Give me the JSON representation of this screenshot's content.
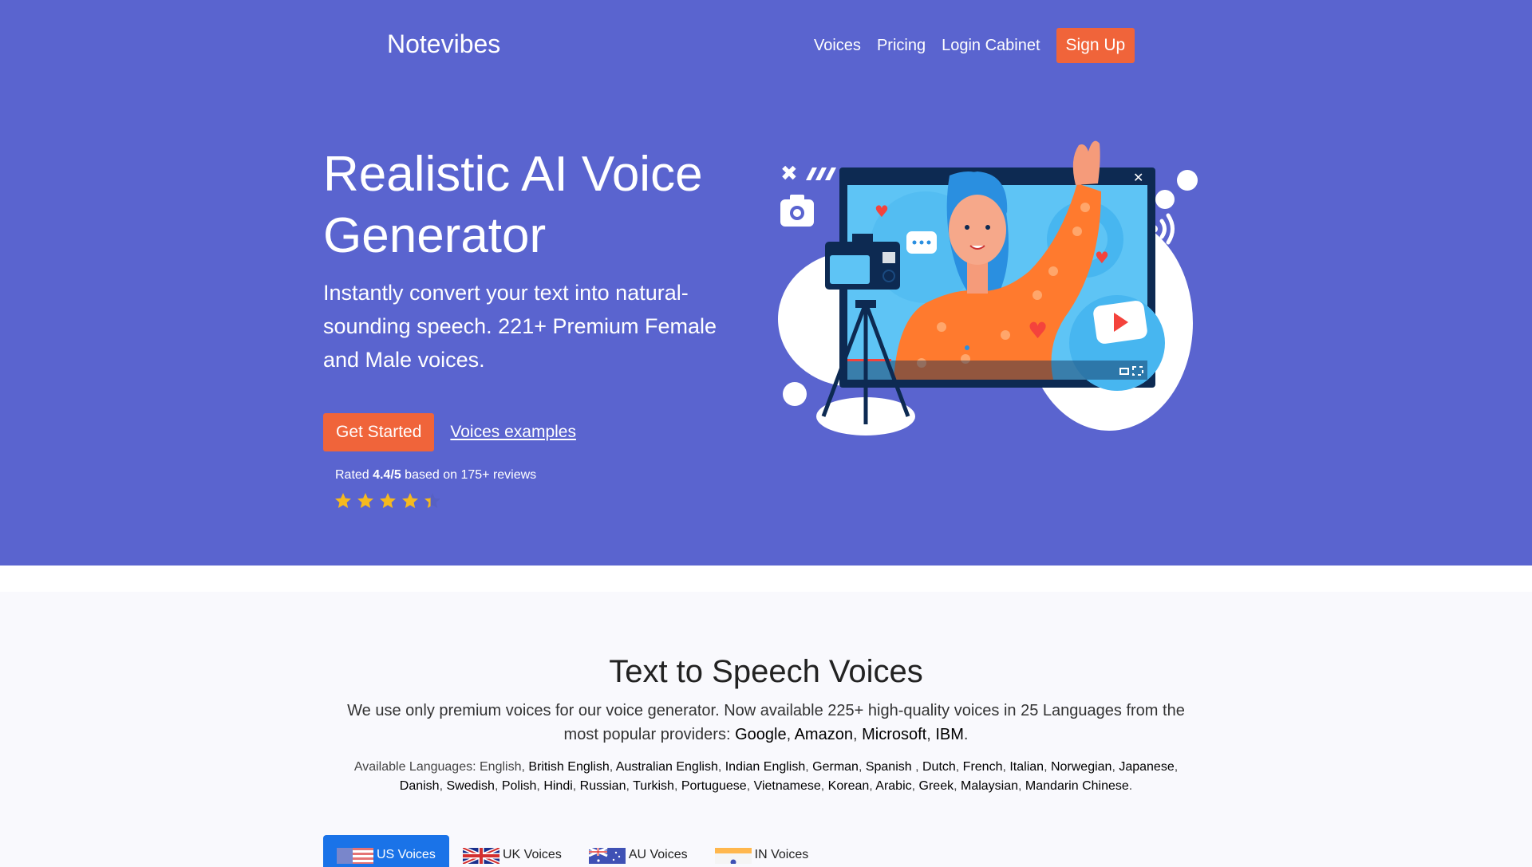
{
  "navbar": {
    "brand": "Notevibes",
    "links": [
      {
        "label": "Voices"
      },
      {
        "label": "Pricing"
      },
      {
        "label": "Login Cabinet"
      }
    ],
    "signup_label": "Sign Up"
  },
  "hero": {
    "title": "Realistic AI Voice Generator",
    "subtitle": "Instantly convert your text into natural-sounding speech. 221+ Premium Female and Male voices.",
    "get_started_label": "Get Started",
    "voices_examples_label": "Voices examples",
    "rating": {
      "prefix": "Rated ",
      "score": "4.4/5",
      "suffix": " based on 175+ reviews",
      "value": 4.4,
      "max": 5
    },
    "illustration_alt": "woman waving in video call with camera on tripod"
  },
  "voices_section": {
    "title": "Text to Speech Voices",
    "description_prefix": "We use only premium voices for our voice generator. Now available 225+ high-quality voices in 25 Languages from the most popular providers: ",
    "providers": [
      "Google",
      "Amazon",
      "Microsoft",
      "IBM"
    ],
    "languages_label": "Available Languages: ",
    "languages": [
      "English",
      "British English",
      "Australian English",
      "Indian English",
      "German",
      "Spanish ",
      "Dutch",
      "French",
      "Italian",
      "Norwegian",
      "Japanese",
      "Danish",
      "Swedish",
      "Polish",
      "Hindi",
      "Russian",
      "Turkish",
      "Portuguese",
      "Vietnamese",
      "Korean",
      "Arabic",
      "Greek",
      "Malaysian",
      "Mandarin Chinese"
    ],
    "tabs": [
      {
        "label": "US Voices",
        "flag": "us-flag",
        "active": true
      },
      {
        "label": "UK Voices",
        "flag": "uk-flag",
        "active": false
      },
      {
        "label": "AU Voices",
        "flag": "au-flag",
        "active": false
      },
      {
        "label": "IN Voices",
        "flag": "in-flag",
        "active": false
      }
    ]
  },
  "colors": {
    "hero_bg": "#5a64cf",
    "accent_orange": "#f0643a",
    "tab_active": "#1a73e8",
    "star": "#f5b91f"
  }
}
